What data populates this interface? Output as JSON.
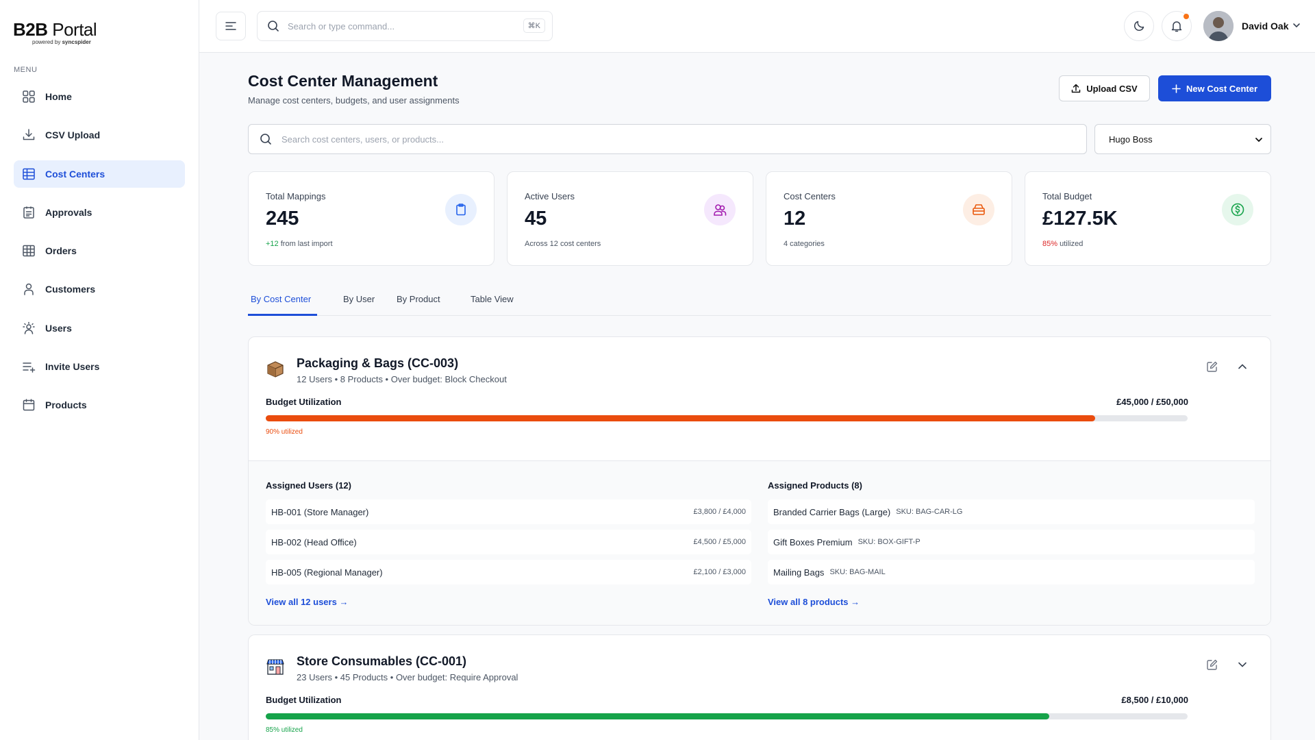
{
  "brand": {
    "name_bold": "B2B",
    "name_rest": " Portal",
    "powered_prefix": "powered by ",
    "powered_brand": "syncspider"
  },
  "sidebar": {
    "menu_label": "MENU",
    "items": [
      {
        "label": "Home",
        "icon": "grid-icon"
      },
      {
        "label": "CSV Upload",
        "icon": "download-icon"
      },
      {
        "label": "Cost Centers",
        "icon": "table-icon",
        "active": true
      },
      {
        "label": "Approvals",
        "icon": "clipboard-list-icon"
      },
      {
        "label": "Orders",
        "icon": "table-icon"
      },
      {
        "label": "Customers",
        "icon": "user-icon"
      },
      {
        "label": "Users",
        "icon": "user-sun-icon"
      },
      {
        "label": "Invite Users",
        "icon": "list-plus-icon"
      },
      {
        "label": "Products",
        "icon": "calendar-icon"
      }
    ]
  },
  "topbar": {
    "search_placeholder": "Search or type command...",
    "shortcut": "⌘K",
    "user_name": "David Oak"
  },
  "page": {
    "title": "Cost Center Management",
    "subtitle": "Manage cost centers, budgets, and user assignments",
    "upload_label": "Upload CSV",
    "new_label": "New Cost Center",
    "search_placeholder": "Search cost centers, users, or products...",
    "company": "Hugo Boss"
  },
  "stats": [
    {
      "label": "Total Mappings",
      "value": "245",
      "note_accent": "+12",
      "note_rest": " from last import",
      "accent_color": "#16a34a",
      "icon": "clipboard-icon",
      "icon_bg": "#e8f0fe",
      "icon_color": "#2563eb"
    },
    {
      "label": "Active Users",
      "value": "45",
      "note_accent": "",
      "note_rest": "Across 12 cost centers",
      "accent_color": "#16a34a",
      "icon": "users-icon",
      "icon_bg": "#f5e8fd",
      "icon_color": "#a21caf"
    },
    {
      "label": "Cost Centers",
      "value": "12",
      "note_accent": "",
      "note_rest": "4 categories",
      "accent_color": "#16a34a",
      "icon": "box-icon",
      "icon_bg": "#fdeee4",
      "icon_color": "#ea580c"
    },
    {
      "label": "Total Budget",
      "value": "£127.5K",
      "note_accent": "85%",
      "note_rest": " utilized",
      "accent_color": "#dc2626",
      "icon": "dollar-icon",
      "icon_bg": "#e6f7ec",
      "icon_color": "#16a34a"
    }
  ],
  "tabs": [
    "By Cost Center",
    "By User",
    "By Product",
    "Table View"
  ],
  "cost_centers": [
    {
      "name": "Packaging & Bags (CC-003)",
      "meta": "12 Users • 8 Products • Over budget: Block Checkout",
      "budget_label": "Budget Utilization",
      "amount": "£45,000 / £50,000",
      "utilization": 0.9,
      "utilization_text": "90% utilized",
      "bar_color": "#ea4c0e",
      "expanded": true,
      "users_title": "Assigned Users (12)",
      "users": [
        {
          "name": "HB-001 (Store Manager)",
          "budget": "£3,800 / £4,000"
        },
        {
          "name": "HB-002 (Head Office)",
          "budget": "£4,500 / £5,000"
        },
        {
          "name": "HB-005 (Regional Manager)",
          "budget": "£2,100 / £3,000"
        }
      ],
      "users_link": "View all 12 users →",
      "products_title": "Assigned Products (8)",
      "products": [
        {
          "name": "Branded Carrier Bags (Large)",
          "sku": "SKU: BAG-CAR-LG"
        },
        {
          "name": "Gift Boxes Premium",
          "sku": "SKU: BOX-GIFT-P"
        },
        {
          "name": "Mailing Bags",
          "sku": "SKU: BAG-MAIL"
        }
      ],
      "products_link": "View all 8 products →"
    },
    {
      "name": "Store Consumables (CC-001)",
      "meta": "23 Users • 45 Products • Over budget: Require Approval",
      "budget_label": "Budget Utilization",
      "amount": "£8,500 / £10,000",
      "utilization": 0.85,
      "utilization_text": "85% utilized",
      "bar_color": "#16a34a",
      "expanded": false
    }
  ]
}
